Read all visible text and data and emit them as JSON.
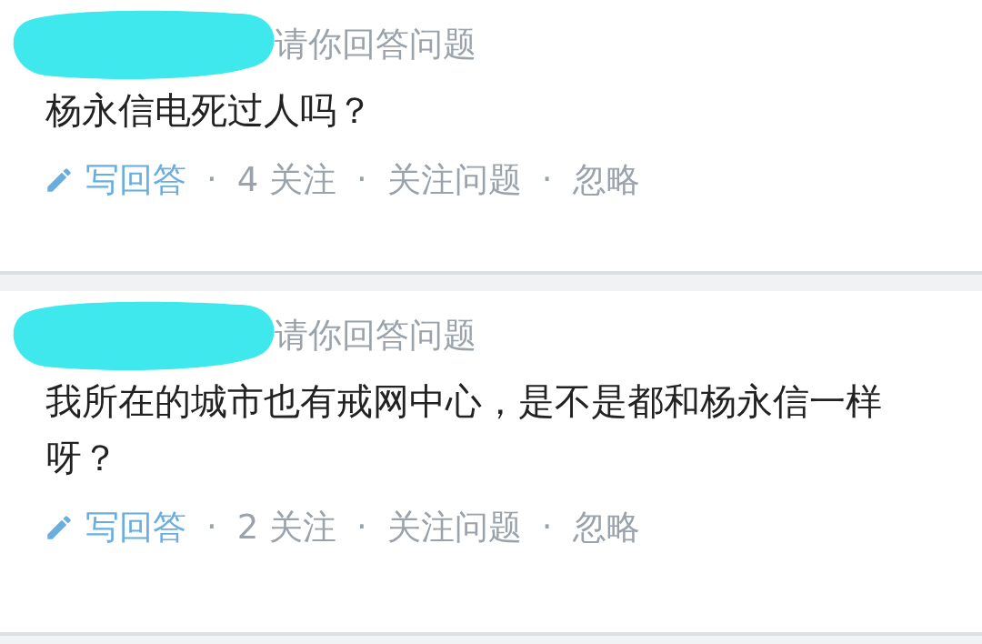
{
  "questions": [
    {
      "invite": "请你回答问题",
      "title": "杨永信电死过人吗？",
      "separator": "·",
      "actions": [
        {
          "kind": "answer",
          "label": "写回答"
        },
        {
          "kind": "text",
          "label": "4 关注"
        },
        {
          "kind": "text",
          "label": "关注问题"
        },
        {
          "kind": "text",
          "label": "忽略"
        }
      ]
    },
    {
      "invite": "请你回答问题",
      "title": "我所在的城市也有戒网中心，是不是都和杨永信一样呀？",
      "separator": "·",
      "actions": [
        {
          "kind": "answer",
          "label": "写回答"
        },
        {
          "kind": "text",
          "label": "2 关注"
        },
        {
          "kind": "text",
          "label": "关注问题"
        },
        {
          "kind": "text",
          "label": "忽略"
        }
      ]
    }
  ]
}
